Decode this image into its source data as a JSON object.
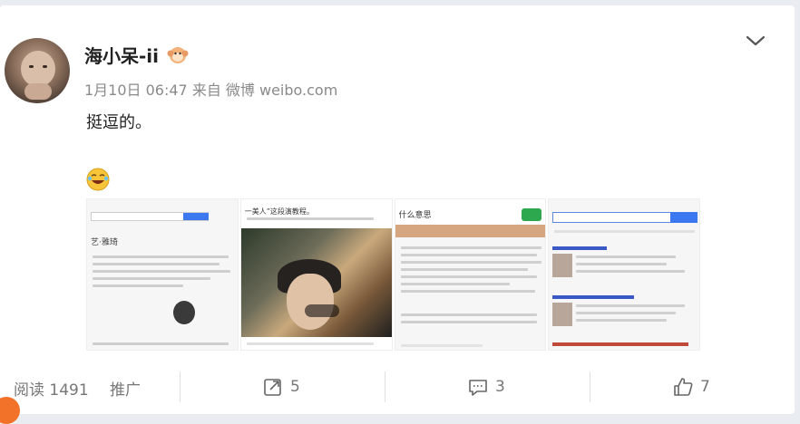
{
  "post": {
    "user_name": "海小呆-ii",
    "meta": "1月10日 06:47 来自 微博 weibo.com",
    "text": "挺逗的。"
  },
  "thumbnails": [
    {
      "title": "艺·雅琦"
    },
    {
      "header": "一美人”这段演教程。"
    },
    {
      "header": "什么意思"
    },
    {
      "header": ""
    }
  ],
  "footer": {
    "read_label": "阅读 1491",
    "promote_label": "推广",
    "repost_count": "5",
    "comment_count": "3",
    "like_count": "7"
  },
  "colors": {
    "accent": "#f2722a",
    "link": "#3c78f0"
  }
}
